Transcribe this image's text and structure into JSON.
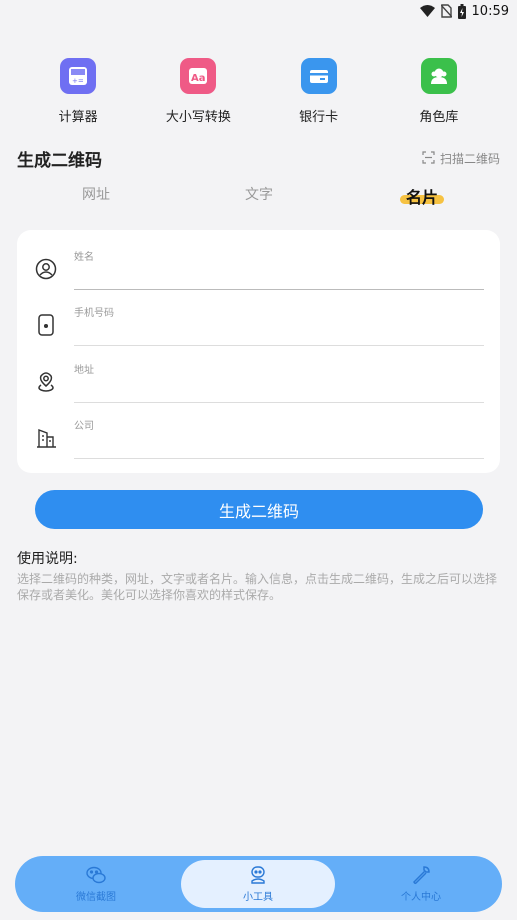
{
  "status_bar": {
    "time": "10:59",
    "icons": [
      "wifi-icon",
      "no-sim-icon",
      "battery-charging-icon"
    ]
  },
  "tools": [
    {
      "label": "计算器",
      "icon": "calculator-icon",
      "color": "#6f6ff2"
    },
    {
      "label": "大小写转换",
      "icon": "letter-case-icon",
      "color": "#ef5a86"
    },
    {
      "label": "银行卡",
      "icon": "bank-card-icon",
      "color": "#3a96ee"
    },
    {
      "label": "角色库",
      "icon": "character-library-icon",
      "color": "#3bc04b"
    }
  ],
  "section": {
    "title": "生成二维码",
    "scan_label": "扫描二维码"
  },
  "tabs": [
    {
      "label": "网址",
      "active": false
    },
    {
      "label": "文字",
      "active": false
    },
    {
      "label": "名片",
      "active": true
    }
  ],
  "form": {
    "fields": [
      {
        "label": "姓名",
        "icon": "person-icon",
        "value": ""
      },
      {
        "label": "手机号码",
        "icon": "phone-icon",
        "value": ""
      },
      {
        "label": "地址",
        "icon": "location-icon",
        "value": ""
      },
      {
        "label": "公司",
        "icon": "company-building-icon",
        "value": ""
      }
    ]
  },
  "generate_button": "生成二维码",
  "help": {
    "title": "使用说明:",
    "text": "选择二维码的种类，网址，文字或者名片。输入信息，点击生成二维码，生成之后可以选择保存或者美化。美化可以选择你喜欢的样式保存。"
  },
  "bottom_nav": [
    {
      "label": "微信截图",
      "icon": "wechat-icon",
      "active": false
    },
    {
      "label": "小工具",
      "icon": "robot-icon",
      "active": true
    },
    {
      "label": "个人中心",
      "icon": "wrench-icon",
      "active": false
    }
  ],
  "colors": {
    "accent": "#2f8ef0",
    "tab_highlight": "#f6c242",
    "nav_bg": "#64aef8"
  }
}
